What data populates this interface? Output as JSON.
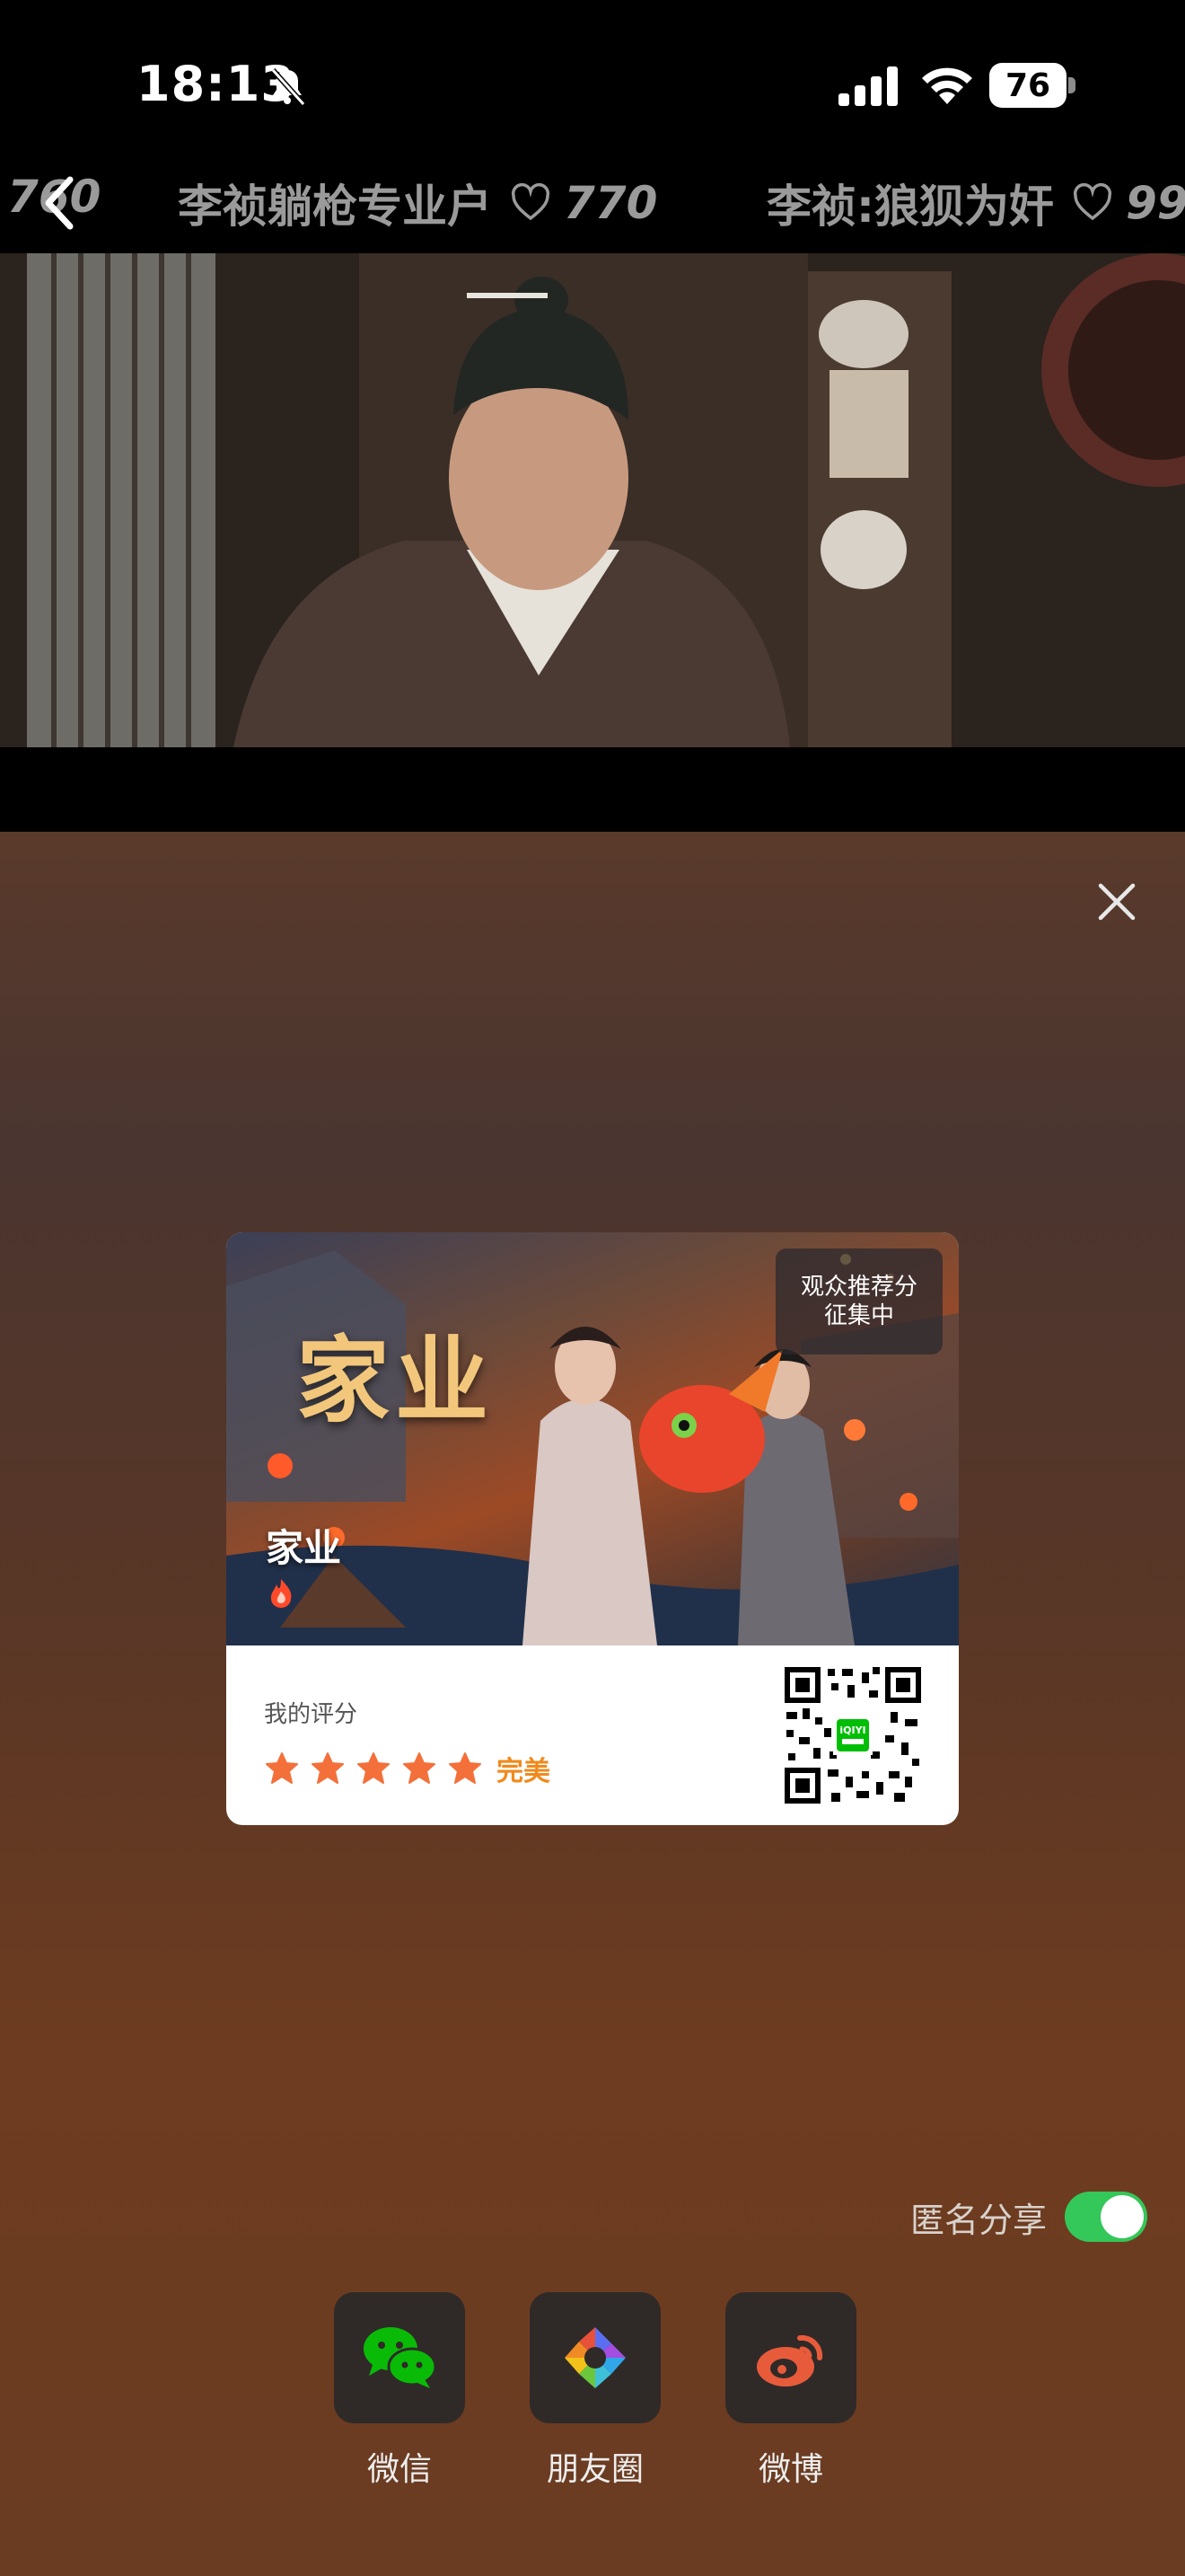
{
  "status_bar": {
    "time": "18:13",
    "battery": "76"
  },
  "danmaku": [
    {
      "text": "",
      "count": "760"
    },
    {
      "text": "李祯躺枪专业户",
      "count": "770"
    },
    {
      "text": "李祯:狼狈为奸",
      "count": "99"
    }
  ],
  "share_card": {
    "poster_art_title": "家业",
    "title": "家业",
    "badge_line1": "观众推荐分",
    "badge_line2": "征集中",
    "rating_label": "我的评分",
    "stars": 5,
    "rating_word": "完美"
  },
  "anonymous_share": {
    "label": "匿名分享",
    "enabled": true
  },
  "share_targets": [
    {
      "label": "微信",
      "icon": "wechat-icon"
    },
    {
      "label": "朋友圈",
      "icon": "moments-icon"
    },
    {
      "label": "微博",
      "icon": "weibo-icon"
    }
  ],
  "colors": {
    "accent_toggle": "#34c759",
    "rating_orange": "#f08a1c",
    "star_orange": "#f4703a"
  }
}
